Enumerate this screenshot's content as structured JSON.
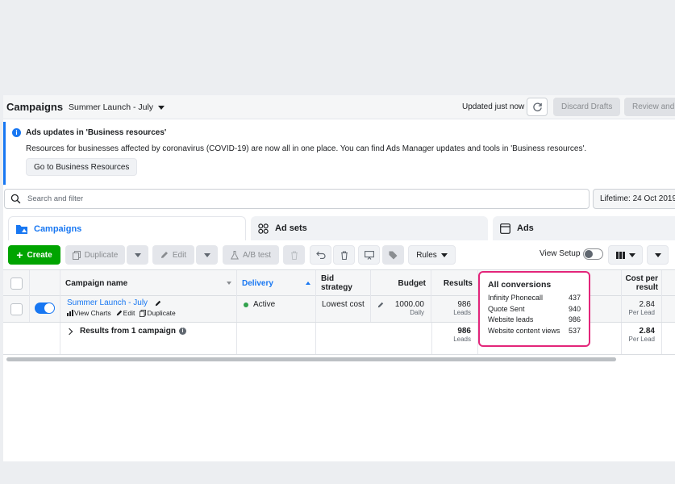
{
  "header": {
    "title": "Campaigns",
    "campaign_selector": "Summer Launch - July",
    "updated": "Updated just now",
    "discard_drafts": "Discard Drafts",
    "review": "Review and"
  },
  "notice": {
    "title": "Ads updates in 'Business resources'",
    "text": "Resources for businesses affected by coronavirus (COVID-19) are now all in one place. You can find Ads Manager updates and tools in 'Business resources'.",
    "button": "Go to Business Resources"
  },
  "search": {
    "placeholder": "Search and filter",
    "date_range": "Lifetime: 24 Oct 2019"
  },
  "tabs": [
    {
      "label": "Campaigns"
    },
    {
      "label": "Ad sets"
    },
    {
      "label": "Ads"
    }
  ],
  "toolbar": {
    "create": "Create",
    "duplicate": "Duplicate",
    "edit": "Edit",
    "ab_test": "A/B test",
    "rules": "Rules",
    "view_setup": "View Setup"
  },
  "table": {
    "columns": {
      "name": "Campaign name",
      "delivery": "Delivery",
      "bid": "Bid strategy",
      "budget": "Budget",
      "results": "Results",
      "cost": "Cost per result"
    },
    "row": {
      "name": "Summer Launch - July",
      "view_charts": "View Charts",
      "edit": "Edit",
      "duplicate": "Duplicate",
      "delivery": "Active",
      "bid": "Lowest cost",
      "budget": "1000.00",
      "budget_sub": "Daily",
      "results": "986",
      "results_sub": "Leads",
      "cost": "2.84",
      "cost_sub": "Per Lead"
    },
    "summary": {
      "label": "Results from 1 campaign",
      "results": "986",
      "results_sub": "Leads",
      "cost": "2.84",
      "cost_sub": "Per Lead"
    }
  },
  "popup": {
    "title": "All conversions",
    "items": [
      {
        "label": "Infinity Phonecall",
        "value": "437"
      },
      {
        "label": "Quote Sent",
        "value": "940"
      },
      {
        "label": "Website leads",
        "value": "986"
      },
      {
        "label": "Website content views",
        "value": "537"
      }
    ]
  },
  "colors": {
    "accent": "#1877f2",
    "create": "#00a400",
    "highlight": "#e3257a"
  }
}
